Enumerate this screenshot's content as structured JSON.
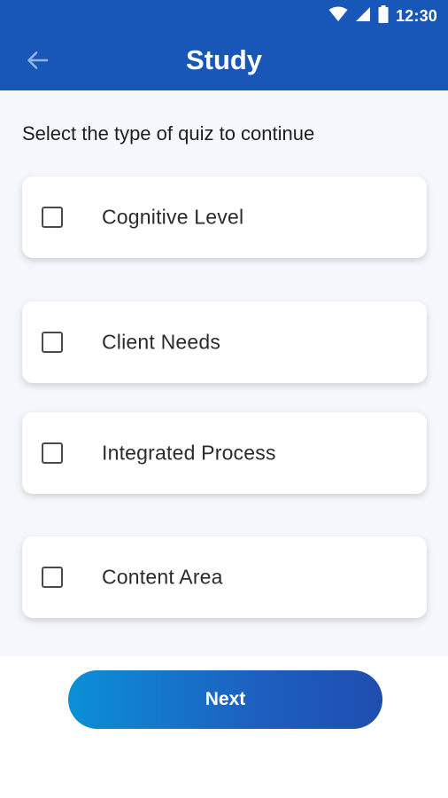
{
  "status_bar": {
    "time": "12:30",
    "icons": [
      "wifi-icon",
      "signal-icon",
      "battery-icon"
    ]
  },
  "header": {
    "title": "Study",
    "back_icon": "back-arrow-icon"
  },
  "instruction": "Select the type of quiz to continue",
  "options": [
    {
      "label": "Cognitive Level",
      "checked": false
    },
    {
      "label": "Client Needs",
      "checked": false
    },
    {
      "label": "Integrated Process",
      "checked": false
    },
    {
      "label": "Content Area",
      "checked": false
    }
  ],
  "next_button": {
    "label": "Next"
  },
  "colors": {
    "header_bg": "#1857b8",
    "content_bg": "#f4f8fc",
    "button_gradient_start": "#0b8fd6",
    "button_gradient_end": "#1e4eb0"
  }
}
